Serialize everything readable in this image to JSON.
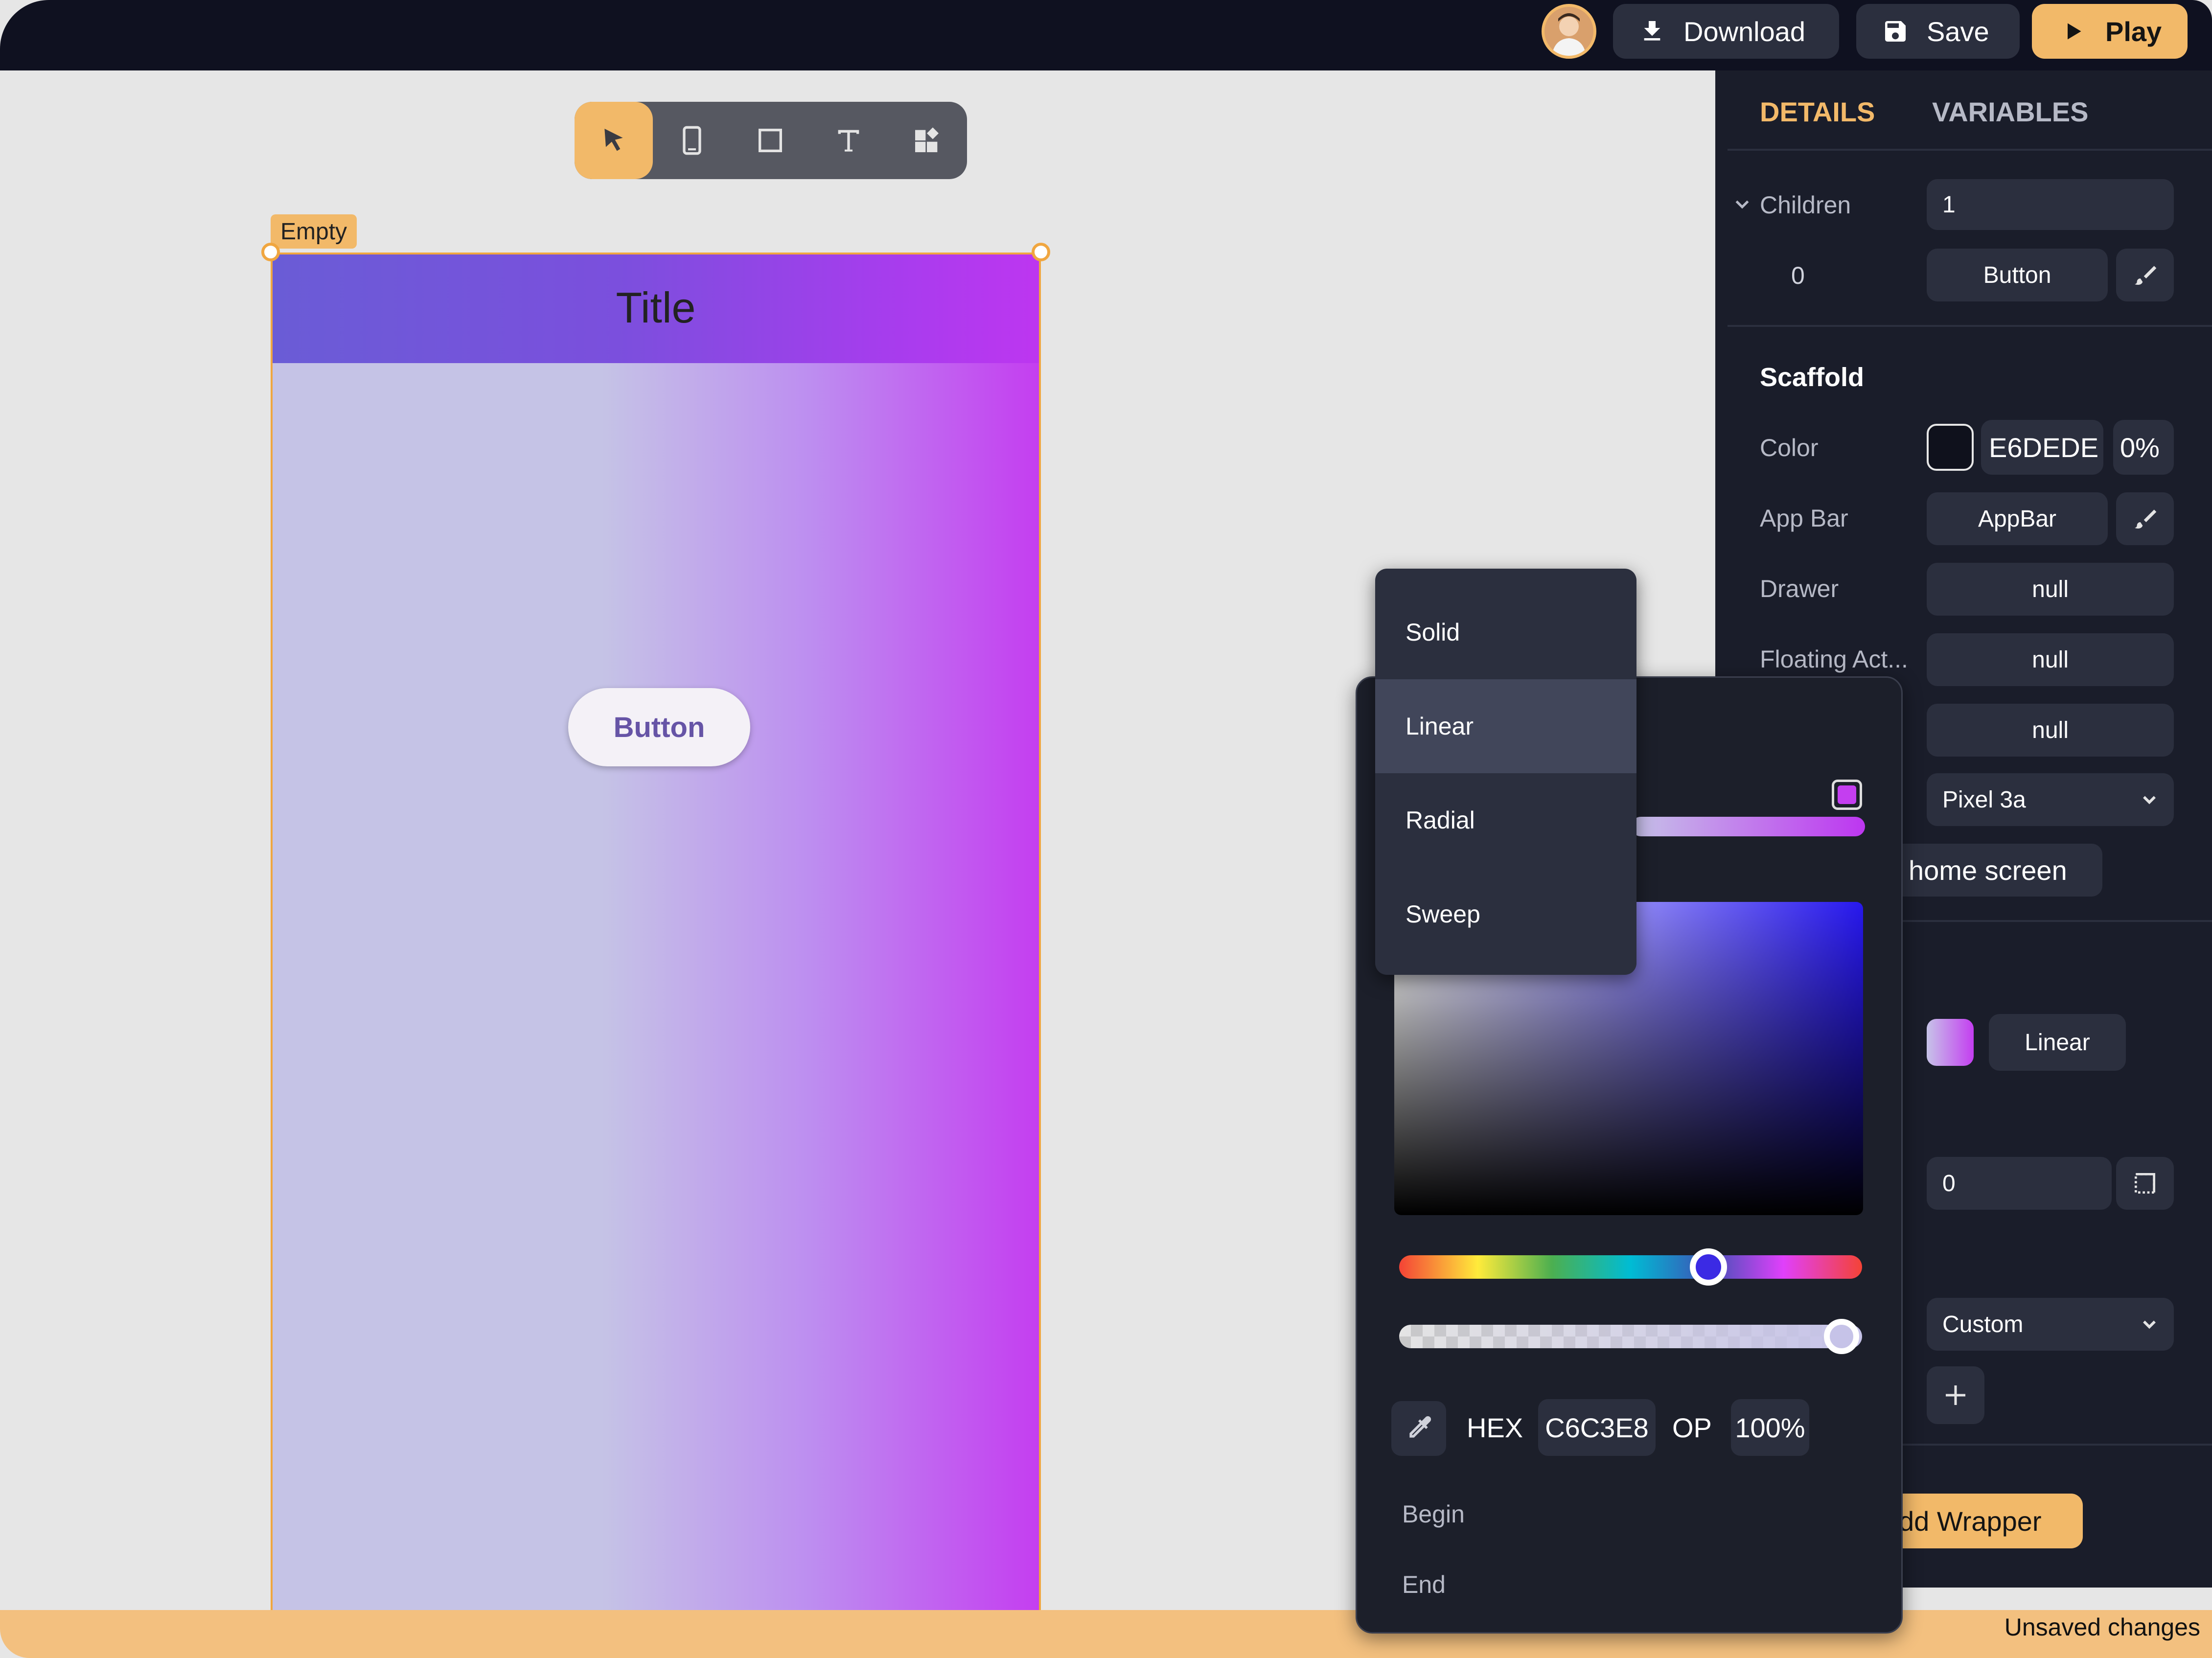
{
  "topbar": {
    "download_label": "Download",
    "save_label": "Save",
    "play_label": "Play"
  },
  "toolbar": {
    "tools": [
      "select-tool",
      "device-tool",
      "container-tool",
      "text-tool",
      "widgets-tool"
    ],
    "active": "select-tool"
  },
  "canvas": {
    "selection_label": "Empty",
    "appbar_title": "Title",
    "button_label": "Button"
  },
  "panel": {
    "tabs": {
      "details": "DETAILS",
      "variables": "VARIABLES",
      "active": "DETAILS"
    },
    "children": {
      "label": "Children",
      "count": "1",
      "index": "0",
      "child_value": "Button"
    },
    "scaffold": {
      "title": "Scaffold",
      "color_label": "Color",
      "color_hex": "E6DEDE",
      "color_opacity": "0%",
      "appbar_label": "App Bar",
      "appbar_value": "AppBar",
      "drawer_label": "Drawer",
      "drawer_value": "null",
      "fab_label": "Floating Act...",
      "fab_value": "null",
      "row5_value": "null",
      "device_value": "Pixel 3a",
      "screen_value": "home screen",
      "gradient_type": "Linear",
      "number_value": "0",
      "custom_value": "Custom",
      "add_wrapper": "dd Wrapper"
    },
    "colors": {
      "accent": "#f2b969",
      "panel_bg": "#1a1d2a",
      "field_bg": "#2b2f3e"
    }
  },
  "picker": {
    "hex_label": "HEX",
    "hex_value": "C6C3E8",
    "op_label": "OP",
    "op_value": "100%",
    "begin_label": "Begin",
    "end_label": "End",
    "hue_fraction": 0.67,
    "alpha_fraction": 1.0
  },
  "gradient_menu": {
    "items": [
      "Solid",
      "Linear",
      "Radial",
      "Sweep"
    ],
    "selected": "Linear"
  },
  "status": {
    "text": "Unsaved changes"
  }
}
